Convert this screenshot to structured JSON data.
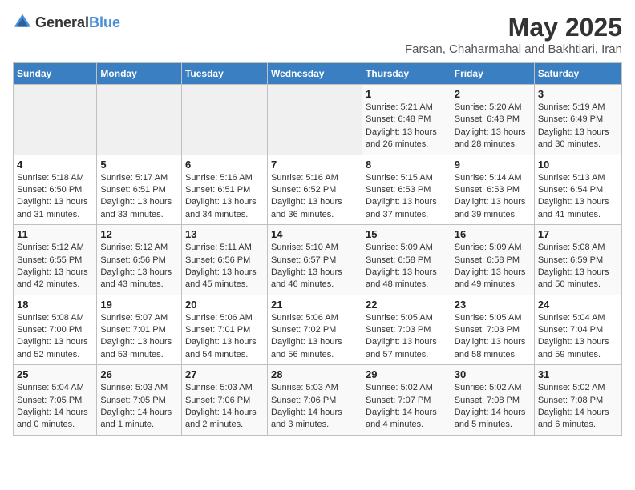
{
  "logo": {
    "text_general": "General",
    "text_blue": "Blue"
  },
  "title": "May 2025",
  "subtitle": "Farsan, Chaharmahal and Bakhtiari, Iran",
  "days_of_week": [
    "Sunday",
    "Monday",
    "Tuesday",
    "Wednesday",
    "Thursday",
    "Friday",
    "Saturday"
  ],
  "weeks": [
    [
      {
        "day": "",
        "info": ""
      },
      {
        "day": "",
        "info": ""
      },
      {
        "day": "",
        "info": ""
      },
      {
        "day": "",
        "info": ""
      },
      {
        "day": "1",
        "sunrise": "Sunrise: 5:21 AM",
        "sunset": "Sunset: 6:48 PM",
        "daylight": "Daylight: 13 hours and 26 minutes."
      },
      {
        "day": "2",
        "sunrise": "Sunrise: 5:20 AM",
        "sunset": "Sunset: 6:48 PM",
        "daylight": "Daylight: 13 hours and 28 minutes."
      },
      {
        "day": "3",
        "sunrise": "Sunrise: 5:19 AM",
        "sunset": "Sunset: 6:49 PM",
        "daylight": "Daylight: 13 hours and 30 minutes."
      }
    ],
    [
      {
        "day": "4",
        "sunrise": "Sunrise: 5:18 AM",
        "sunset": "Sunset: 6:50 PM",
        "daylight": "Daylight: 13 hours and 31 minutes."
      },
      {
        "day": "5",
        "sunrise": "Sunrise: 5:17 AM",
        "sunset": "Sunset: 6:51 PM",
        "daylight": "Daylight: 13 hours and 33 minutes."
      },
      {
        "day": "6",
        "sunrise": "Sunrise: 5:16 AM",
        "sunset": "Sunset: 6:51 PM",
        "daylight": "Daylight: 13 hours and 34 minutes."
      },
      {
        "day": "7",
        "sunrise": "Sunrise: 5:16 AM",
        "sunset": "Sunset: 6:52 PM",
        "daylight": "Daylight: 13 hours and 36 minutes."
      },
      {
        "day": "8",
        "sunrise": "Sunrise: 5:15 AM",
        "sunset": "Sunset: 6:53 PM",
        "daylight": "Daylight: 13 hours and 37 minutes."
      },
      {
        "day": "9",
        "sunrise": "Sunrise: 5:14 AM",
        "sunset": "Sunset: 6:53 PM",
        "daylight": "Daylight: 13 hours and 39 minutes."
      },
      {
        "day": "10",
        "sunrise": "Sunrise: 5:13 AM",
        "sunset": "Sunset: 6:54 PM",
        "daylight": "Daylight: 13 hours and 41 minutes."
      }
    ],
    [
      {
        "day": "11",
        "sunrise": "Sunrise: 5:12 AM",
        "sunset": "Sunset: 6:55 PM",
        "daylight": "Daylight: 13 hours and 42 minutes."
      },
      {
        "day": "12",
        "sunrise": "Sunrise: 5:12 AM",
        "sunset": "Sunset: 6:56 PM",
        "daylight": "Daylight: 13 hours and 43 minutes."
      },
      {
        "day": "13",
        "sunrise": "Sunrise: 5:11 AM",
        "sunset": "Sunset: 6:56 PM",
        "daylight": "Daylight: 13 hours and 45 minutes."
      },
      {
        "day": "14",
        "sunrise": "Sunrise: 5:10 AM",
        "sunset": "Sunset: 6:57 PM",
        "daylight": "Daylight: 13 hours and 46 minutes."
      },
      {
        "day": "15",
        "sunrise": "Sunrise: 5:09 AM",
        "sunset": "Sunset: 6:58 PM",
        "daylight": "Daylight: 13 hours and 48 minutes."
      },
      {
        "day": "16",
        "sunrise": "Sunrise: 5:09 AM",
        "sunset": "Sunset: 6:58 PM",
        "daylight": "Daylight: 13 hours and 49 minutes."
      },
      {
        "day": "17",
        "sunrise": "Sunrise: 5:08 AM",
        "sunset": "Sunset: 6:59 PM",
        "daylight": "Daylight: 13 hours and 50 minutes."
      }
    ],
    [
      {
        "day": "18",
        "sunrise": "Sunrise: 5:08 AM",
        "sunset": "Sunset: 7:00 PM",
        "daylight": "Daylight: 13 hours and 52 minutes."
      },
      {
        "day": "19",
        "sunrise": "Sunrise: 5:07 AM",
        "sunset": "Sunset: 7:01 PM",
        "daylight": "Daylight: 13 hours and 53 minutes."
      },
      {
        "day": "20",
        "sunrise": "Sunrise: 5:06 AM",
        "sunset": "Sunset: 7:01 PM",
        "daylight": "Daylight: 13 hours and 54 minutes."
      },
      {
        "day": "21",
        "sunrise": "Sunrise: 5:06 AM",
        "sunset": "Sunset: 7:02 PM",
        "daylight": "Daylight: 13 hours and 56 minutes."
      },
      {
        "day": "22",
        "sunrise": "Sunrise: 5:05 AM",
        "sunset": "Sunset: 7:03 PM",
        "daylight": "Daylight: 13 hours and 57 minutes."
      },
      {
        "day": "23",
        "sunrise": "Sunrise: 5:05 AM",
        "sunset": "Sunset: 7:03 PM",
        "daylight": "Daylight: 13 hours and 58 minutes."
      },
      {
        "day": "24",
        "sunrise": "Sunrise: 5:04 AM",
        "sunset": "Sunset: 7:04 PM",
        "daylight": "Daylight: 13 hours and 59 minutes."
      }
    ],
    [
      {
        "day": "25",
        "sunrise": "Sunrise: 5:04 AM",
        "sunset": "Sunset: 7:05 PM",
        "daylight": "Daylight: 14 hours and 0 minutes."
      },
      {
        "day": "26",
        "sunrise": "Sunrise: 5:03 AM",
        "sunset": "Sunset: 7:05 PM",
        "daylight": "Daylight: 14 hours and 1 minute."
      },
      {
        "day": "27",
        "sunrise": "Sunrise: 5:03 AM",
        "sunset": "Sunset: 7:06 PM",
        "daylight": "Daylight: 14 hours and 2 minutes."
      },
      {
        "day": "28",
        "sunrise": "Sunrise: 5:03 AM",
        "sunset": "Sunset: 7:06 PM",
        "daylight": "Daylight: 14 hours and 3 minutes."
      },
      {
        "day": "29",
        "sunrise": "Sunrise: 5:02 AM",
        "sunset": "Sunset: 7:07 PM",
        "daylight": "Daylight: 14 hours and 4 minutes."
      },
      {
        "day": "30",
        "sunrise": "Sunrise: 5:02 AM",
        "sunset": "Sunset: 7:08 PM",
        "daylight": "Daylight: 14 hours and 5 minutes."
      },
      {
        "day": "31",
        "sunrise": "Sunrise: 5:02 AM",
        "sunset": "Sunset: 7:08 PM",
        "daylight": "Daylight: 14 hours and 6 minutes."
      }
    ]
  ]
}
